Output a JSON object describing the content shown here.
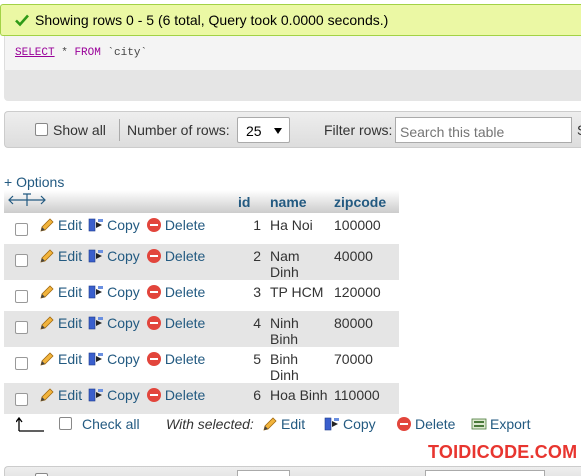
{
  "message": {
    "text": "Showing rows 0 - 5 (6 total, Query took 0.0000 seconds.)",
    "icon": "check-icon",
    "background_color": "#ebf8a4"
  },
  "sql": {
    "select": "SELECT",
    "star": "*",
    "from": "FROM",
    "table": "`city`"
  },
  "navigation": {
    "show_all_label": "Show all",
    "rows_label": "Number of rows:",
    "rows_value": "25",
    "filter_label": "Filter rows:",
    "filter_placeholder": "Search this table",
    "cut_off_letter": "S"
  },
  "options_label": "+ Options",
  "table": {
    "columns": [
      "id",
      "name",
      "zipcode"
    ],
    "actions": {
      "edit": "Edit",
      "copy": "Copy",
      "delete": "Delete"
    },
    "rows": [
      {
        "id": "1",
        "name": "Ha Noi",
        "zipcode": "100000"
      },
      {
        "id": "2",
        "name": "Nam Dinh",
        "zipcode": "40000"
      },
      {
        "id": "3",
        "name": "TP HCM",
        "zipcode": "120000"
      },
      {
        "id": "4",
        "name": "Ninh Binh",
        "zipcode": "80000"
      },
      {
        "id": "5",
        "name": "Binh Dinh",
        "zipcode": "70000"
      },
      {
        "id": "6",
        "name": "Hoa Binh",
        "zipcode": "110000"
      }
    ]
  },
  "footer": {
    "check_all": "Check all",
    "with_selected": "With selected:",
    "edit": "Edit",
    "copy": "Copy",
    "delete": "Delete",
    "export": "Export"
  },
  "watermark": "TOIDICODE.COM",
  "colors": {
    "link": "#235a81",
    "watermark": "#e8352f",
    "even_row": "#e5e5e5"
  }
}
